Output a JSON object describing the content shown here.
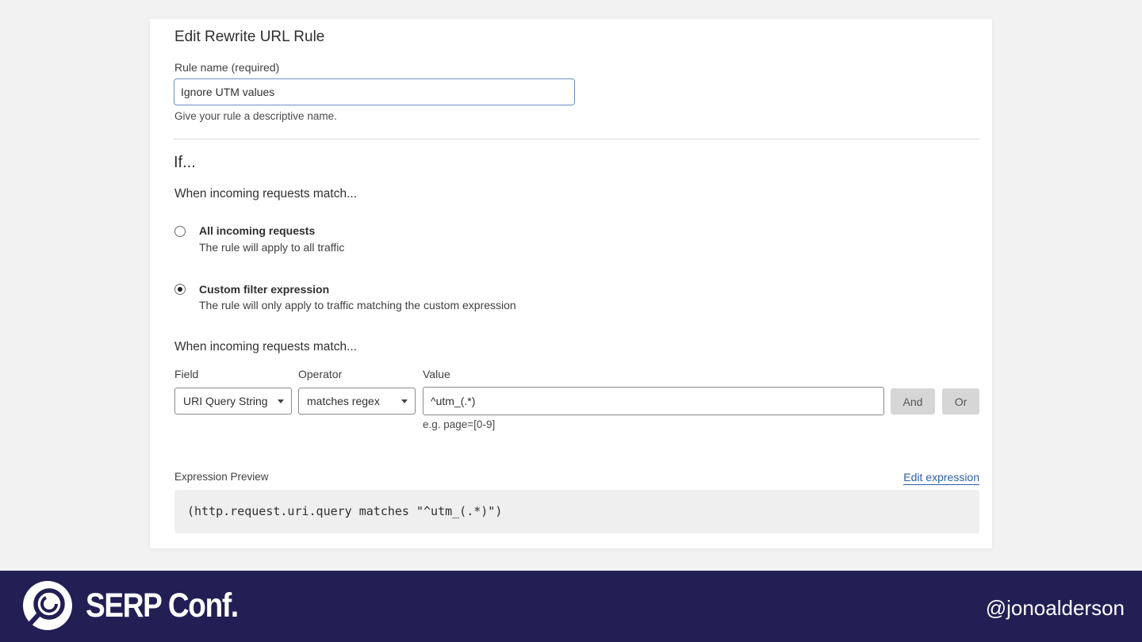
{
  "form": {
    "title": "Edit Rewrite URL Rule",
    "rule_name_label": "Rule name (required)",
    "rule_name_value": "Ignore UTM values",
    "rule_name_help": "Give your rule a descriptive name.",
    "if_heading": "If...",
    "match_heading_1": "When incoming requests match...",
    "options": [
      {
        "title": "All incoming requests",
        "description": "The rule will apply to all traffic",
        "selected": false
      },
      {
        "title": "Custom filter expression",
        "description": "The rule will only apply to traffic matching the custom expression",
        "selected": true
      }
    ],
    "match_heading_2": "When incoming requests match...",
    "filter": {
      "field_label": "Field",
      "field_value": "URI Query String",
      "operator_label": "Operator",
      "operator_value": "matches regex",
      "value_label": "Value",
      "value_value": "^utm_(.*)",
      "value_hint": "e.g. page=[0-9]",
      "and_button": "And",
      "or_button": "Or"
    },
    "preview": {
      "label": "Expression Preview",
      "edit_link": "Edit expression",
      "expression": "(http.request.uri.query matches \"^utm_(.*)\")"
    }
  },
  "footer": {
    "brand": "SERP Conf.",
    "handle": "@jonoalderson",
    "background_color": "#221f55",
    "logo_icon": "serp-conf-logo-icon"
  }
}
